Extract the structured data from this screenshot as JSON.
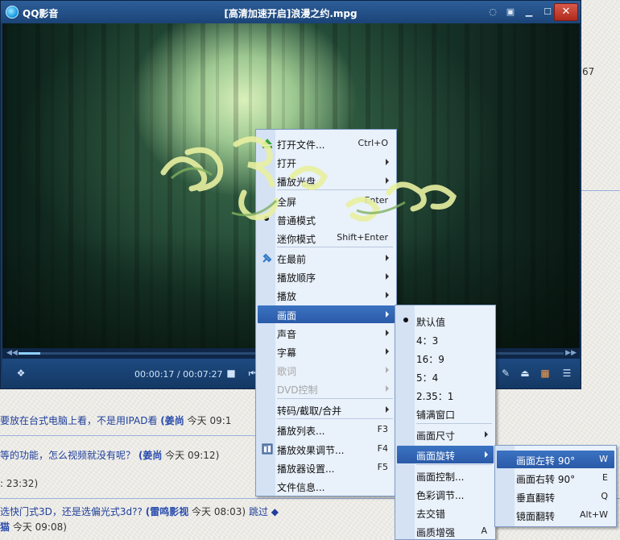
{
  "window": {
    "app_name": "QQ影音",
    "title": "[高清加速开启]浪漫之约.mpg"
  },
  "player": {
    "time": "00:00:17 / 00:07:27",
    "seek_progress": 0.04
  },
  "main_menu": [
    {
      "label": "打开文件...",
      "shortcut": "Ctrl+O",
      "icon": "eject-icon"
    },
    {
      "label": "打开",
      "submenu": true
    },
    {
      "label": "播放光盘",
      "submenu": true
    },
    {
      "label": "全屏",
      "shortcut": "Enter"
    },
    {
      "label": "普通模式",
      "checked": true
    },
    {
      "label": "迷你模式",
      "shortcut": "Shift+Enter"
    },
    {
      "label": "在最前",
      "submenu": true,
      "icon": "pin-icon"
    },
    {
      "label": "播放顺序",
      "submenu": true
    },
    {
      "label": "播放",
      "submenu": true
    },
    {
      "label": "画面",
      "submenu": true,
      "highlighted": true
    },
    {
      "label": "声音",
      "submenu": true
    },
    {
      "label": "字幕",
      "submenu": true
    },
    {
      "label": "歌词",
      "submenu": true,
      "disabled": true
    },
    {
      "label": "DVD控制",
      "submenu": true,
      "disabled": true
    },
    {
      "label": "转码/截取/合并",
      "submenu": true
    },
    {
      "label": "播放列表...",
      "shortcut": "F3"
    },
    {
      "label": "播放效果调节...",
      "shortcut": "F4",
      "icon": "effects-icon"
    },
    {
      "label": "播放器设置...",
      "shortcut": "F5"
    },
    {
      "label": "文件信息..."
    }
  ],
  "picture_menu": [
    {
      "label": "默认值",
      "checked": true
    },
    {
      "label": "4：3"
    },
    {
      "label": "16：9"
    },
    {
      "label": "5：4"
    },
    {
      "label": "2.35：1"
    },
    {
      "label": "铺满窗口"
    },
    {
      "label": "画面尺寸",
      "submenu": true
    },
    {
      "label": "画面旋转",
      "submenu": true,
      "highlighted": true
    },
    {
      "label": "画面控制..."
    },
    {
      "label": "色彩调节..."
    },
    {
      "label": "去交错"
    },
    {
      "label": "画质增强",
      "shortcut": "A"
    }
  ],
  "rotate_menu": [
    {
      "label": "画面左转 90°",
      "shortcut": "W",
      "highlighted": true
    },
    {
      "label": "画面右转 90°",
      "shortcut": "E"
    },
    {
      "label": "垂直翻转",
      "shortcut": "Q"
    },
    {
      "label": "镜面翻转",
      "shortcut": "Alt+W"
    }
  ],
  "background": {
    "frag_67": "67",
    "line1_text": "要放在台式电脑上看，不是用IPAD看",
    "line1_user": "(姜尚",
    "line1_time": "今天 09:1",
    "line2_text": "等的功能，怎么视频就没有呢？",
    "line2_user": "(姜尚",
    "line2_time": "今天 09:12)",
    "line3_time": ": 23:32)",
    "line4_text": "选快门式3D，还是选偏光式3d??",
    "line4_user": "(雷鸣影视",
    "line4_time": "今天 08:03)",
    "line4_tail": "跳过",
    "line5_name": "猫",
    "line5_time": "今天 09:08)"
  }
}
